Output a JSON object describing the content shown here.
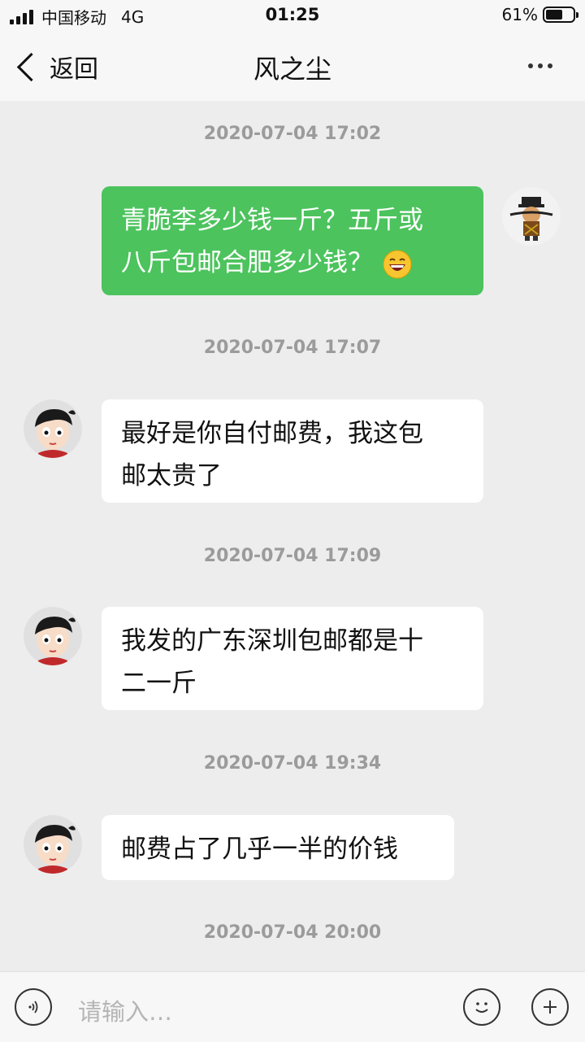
{
  "status_bar": {
    "carrier": "中国移动",
    "network": "4G",
    "time": "01:25",
    "battery": "61%",
    "battery_level": 0.61
  },
  "nav": {
    "back_label": "返回",
    "title": "风之尘",
    "more_icon": "ellipsis-icon"
  },
  "messages": [
    {
      "timestamp": "2020-07-04 17:02",
      "from": "me",
      "lines": [
        "青脆李多少钱一斤？五斤或",
        "八斤包邮合肥多少钱？"
      ],
      "emoji": "grinning-face"
    },
    {
      "timestamp": "2020-07-04 17:07",
      "from": "other",
      "lines": [
        "最好是你自付邮费，我这包",
        "邮太贵了"
      ]
    },
    {
      "timestamp": "2020-07-04 17:09",
      "from": "other",
      "lines": [
        "我发的广东深圳包邮都是十",
        "二一斤"
      ]
    },
    {
      "timestamp": "2020-07-04 19:34",
      "from": "other",
      "lines": [
        "邮费占了几乎一半的价钱"
      ]
    }
  ],
  "last_timestamp": "2020-07-04 20:00",
  "input_bar": {
    "placeholder": "请输入…",
    "voice_icon": "voice-icon",
    "emoji_icon": "smiley-icon",
    "add_icon": "plus-icon"
  },
  "colors": {
    "my_bubble": "#4cc35d",
    "other_bubble": "#ffffff",
    "background": "#ededed"
  }
}
